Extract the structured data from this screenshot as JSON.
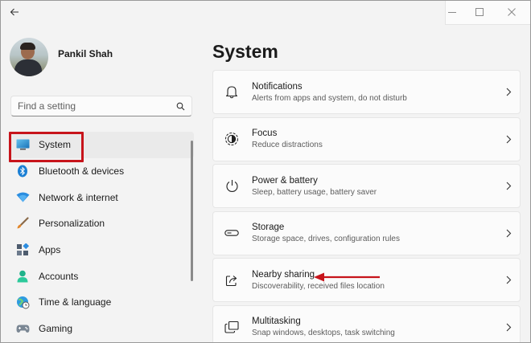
{
  "window": {
    "controls": {
      "minimize": "minimize-icon",
      "maximize": "maximize-icon",
      "close": "close-icon"
    }
  },
  "profile": {
    "name": "Pankil Shah"
  },
  "search": {
    "placeholder": "Find a setting"
  },
  "sidebar": {
    "items": [
      {
        "label": "System",
        "icon": "system-icon",
        "active": true
      },
      {
        "label": "Bluetooth & devices",
        "icon": "bluetooth-icon"
      },
      {
        "label": "Network & internet",
        "icon": "wifi-icon"
      },
      {
        "label": "Personalization",
        "icon": "brush-icon"
      },
      {
        "label": "Apps",
        "icon": "apps-icon"
      },
      {
        "label": "Accounts",
        "icon": "person-icon"
      },
      {
        "label": "Time & language",
        "icon": "globe-clock-icon"
      },
      {
        "label": "Gaming",
        "icon": "gamepad-icon"
      }
    ]
  },
  "main": {
    "title": "System",
    "cards": [
      {
        "title": "Notifications",
        "subtitle": "Alerts from apps and system, do not disturb",
        "icon": "bell-icon"
      },
      {
        "title": "Focus",
        "subtitle": "Reduce distractions",
        "icon": "focus-icon"
      },
      {
        "title": "Power & battery",
        "subtitle": "Sleep, battery usage, battery saver",
        "icon": "power-icon"
      },
      {
        "title": "Storage",
        "subtitle": "Storage space, drives, configuration rules",
        "icon": "storage-icon"
      },
      {
        "title": "Nearby sharing",
        "subtitle": "Discoverability, received files location",
        "icon": "share-icon"
      },
      {
        "title": "Multitasking",
        "subtitle": "Snap windows, desktops, task switching",
        "icon": "multitask-icon"
      }
    ]
  },
  "colors": {
    "highlight": "#c7141b",
    "accent": "#0067c0"
  }
}
